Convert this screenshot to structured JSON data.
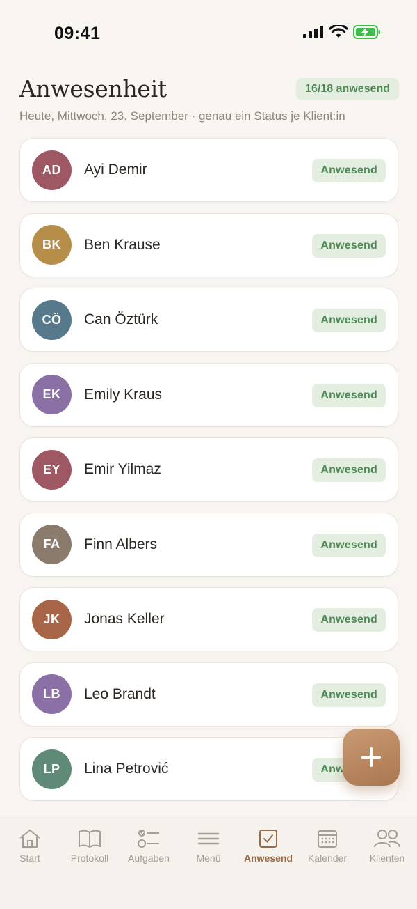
{
  "status_bar": {
    "time": "09:41"
  },
  "header": {
    "title": "Anwesenheit",
    "count_badge": "16/18 anwesend",
    "subtitle": "Heute, Mittwoch, 23. September · genau ein Status je Klient:in"
  },
  "clients": [
    {
      "initials": "AD",
      "name": "Ayi Demir",
      "status": "Anwesend",
      "color": "#9e5864"
    },
    {
      "initials": "BK",
      "name": "Ben Krause",
      "status": "Anwesend",
      "color": "#b68e4a"
    },
    {
      "initials": "CÖ",
      "name": "Can Öztürk",
      "status": "Anwesend",
      "color": "#56798c"
    },
    {
      "initials": "EK",
      "name": "Emily Kraus",
      "status": "Anwesend",
      "color": "#8a70a5"
    },
    {
      "initials": "EY",
      "name": "Emir Yilmaz",
      "status": "Anwesend",
      "color": "#9e5864"
    },
    {
      "initials": "FA",
      "name": "Finn Albers",
      "status": "Anwesend",
      "color": "#8b7b6c"
    },
    {
      "initials": "JK",
      "name": "Jonas Keller",
      "status": "Anwesend",
      "color": "#a86548"
    },
    {
      "initials": "LB",
      "name": "Leo Brandt",
      "status": "Anwesend",
      "color": "#8a70a5"
    },
    {
      "initials": "LP",
      "name": "Lina Petrović",
      "status": "Anwesend",
      "color": "#5f8a77"
    }
  ],
  "tabbar": {
    "items": [
      {
        "label": "Start",
        "icon": "home-icon"
      },
      {
        "label": "Protokoll",
        "icon": "book-icon"
      },
      {
        "label": "Aufgaben",
        "icon": "checklist-icon"
      },
      {
        "label": "Menü",
        "icon": "menu-icon"
      },
      {
        "label": "Anwesend",
        "icon": "checkbox-icon",
        "active": true
      },
      {
        "label": "Kalender",
        "icon": "calendar-icon"
      },
      {
        "label": "Klienten",
        "icon": "people-icon"
      }
    ]
  },
  "colors": {
    "background": "#f8f5f1",
    "accent": "#9a6a45",
    "status_green": "#4e8a55",
    "status_bg": "#e3eee1"
  }
}
